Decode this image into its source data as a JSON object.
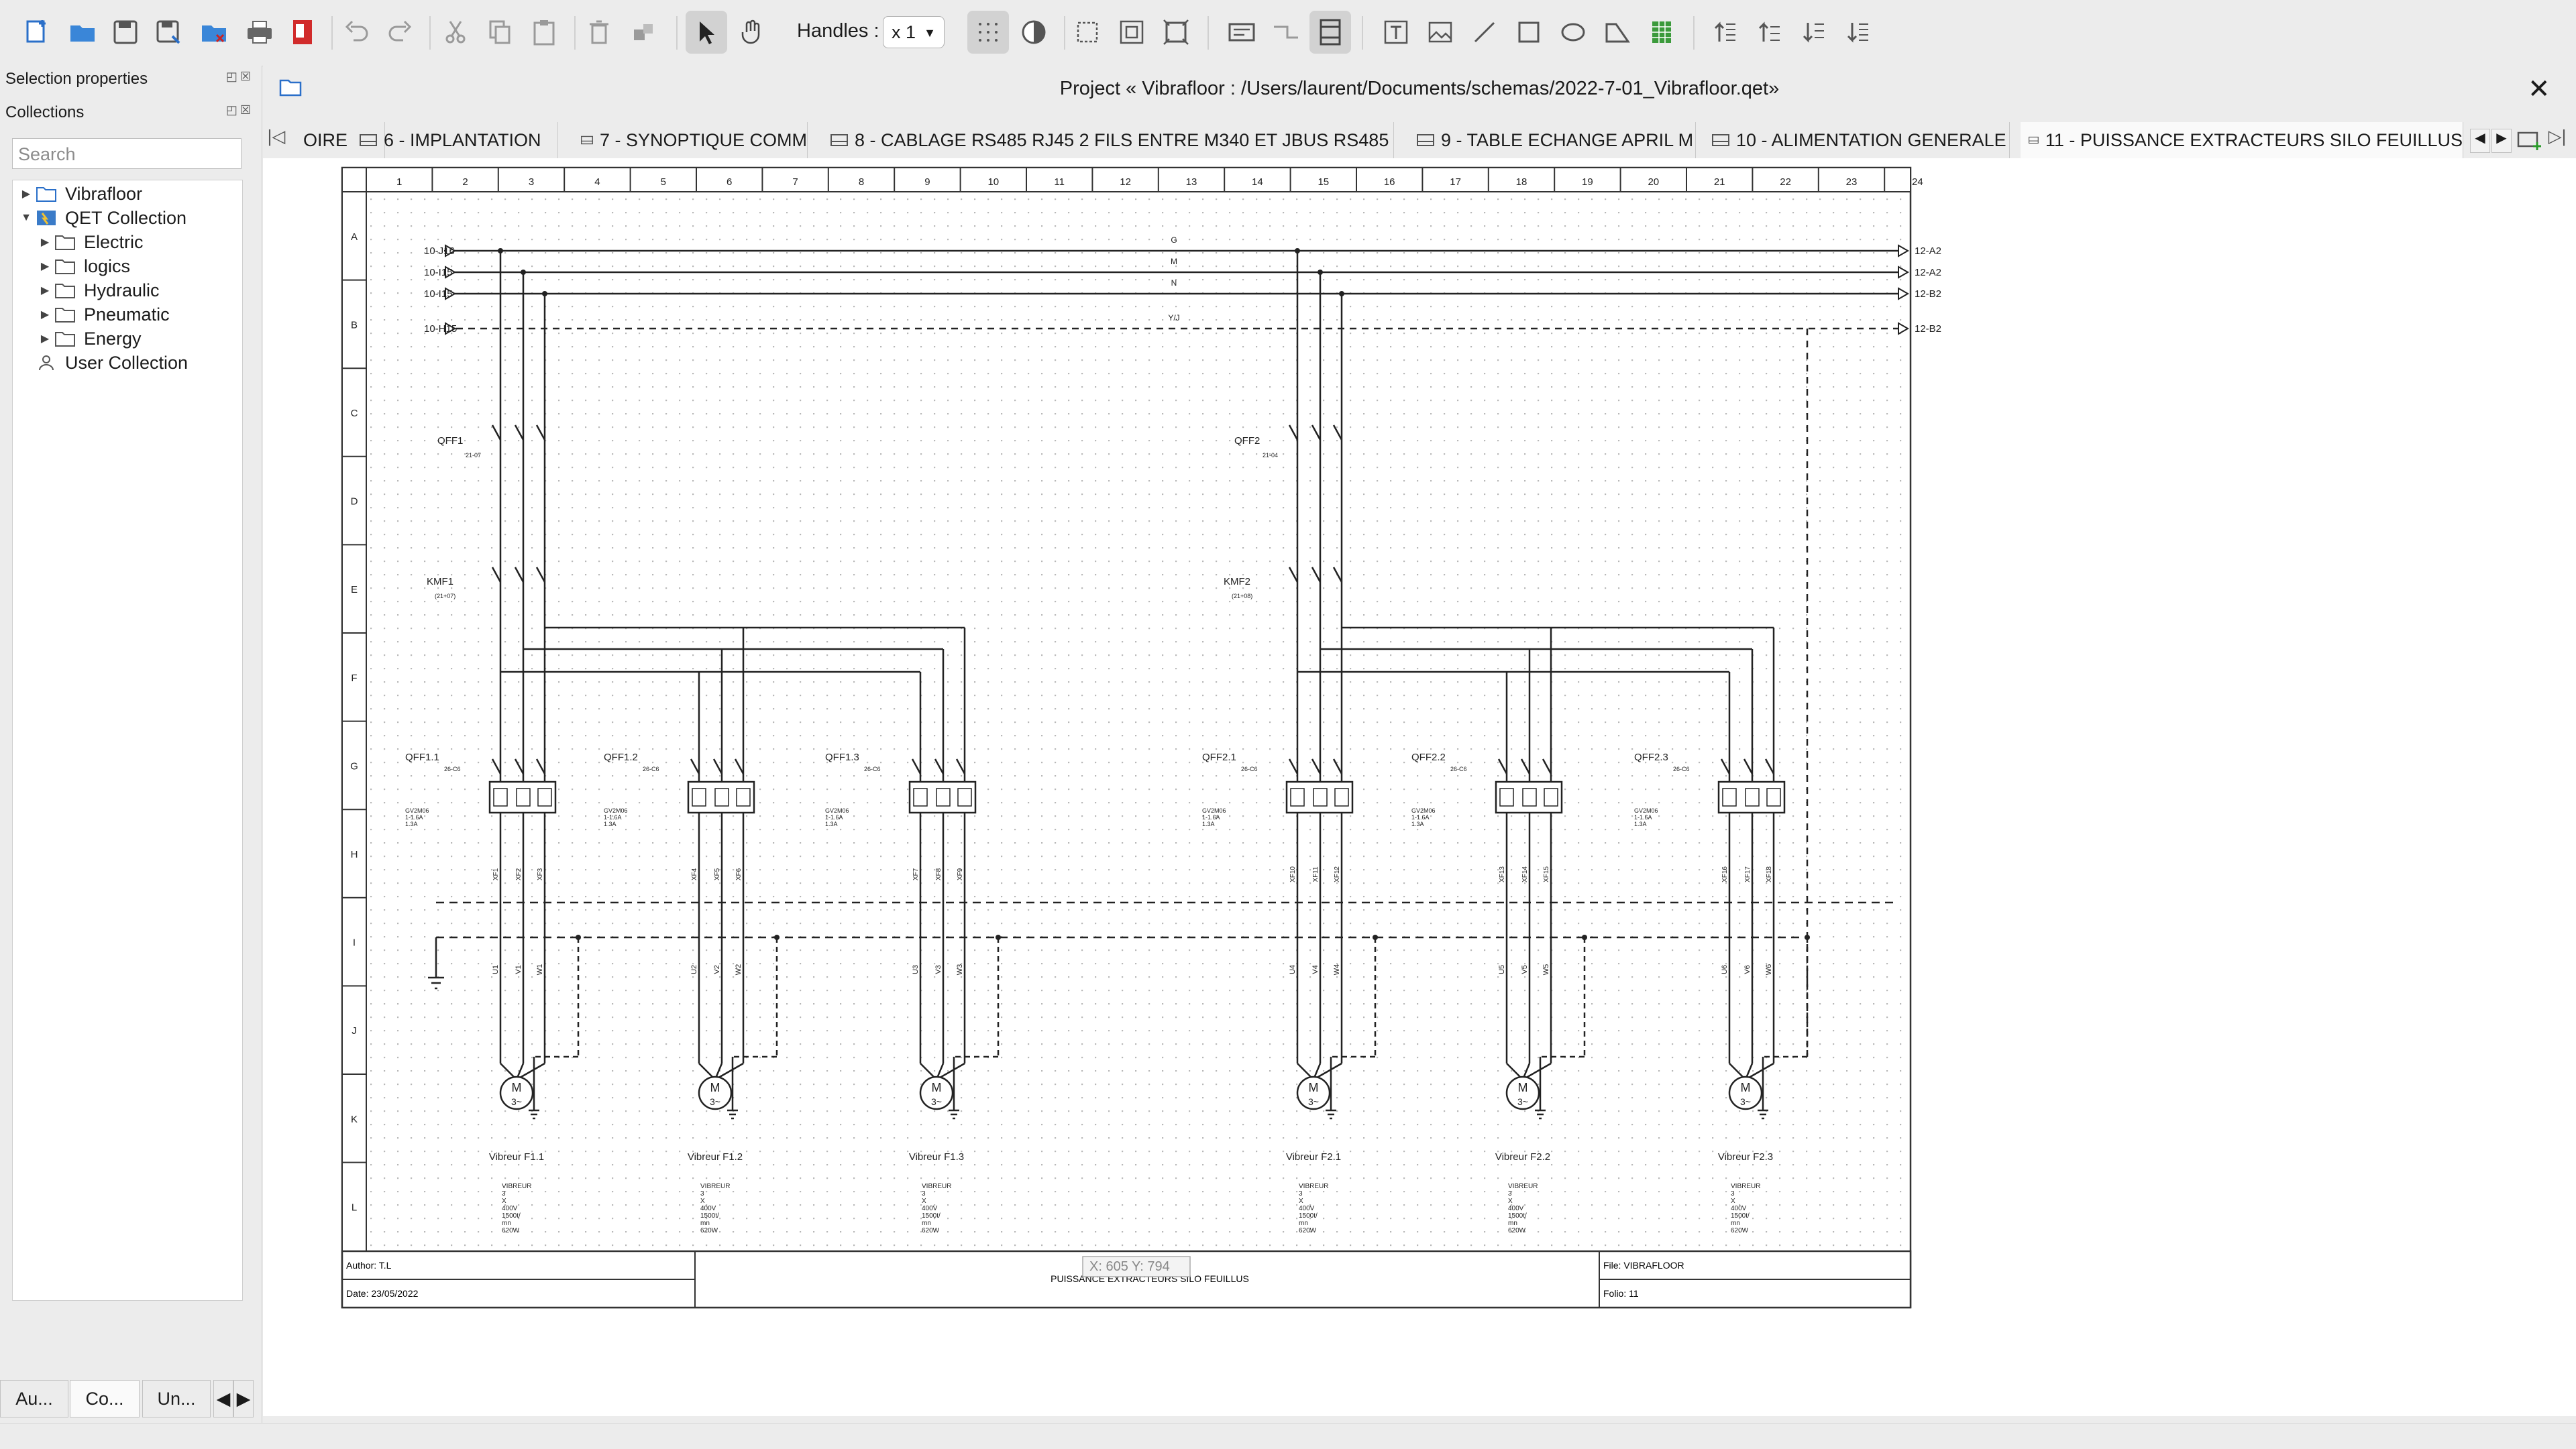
{
  "toolbar": {
    "handles_label": "Handles :",
    "handles_value": "x 1",
    "icons": [
      "new-project-icon",
      "open-icon",
      "save-icon",
      "save-as-icon",
      "close-project-icon",
      "print-icon",
      "export-pdf-icon",
      "undo-icon",
      "redo-icon",
      "cut-icon",
      "copy-icon",
      "paste-icon",
      "delete-icon",
      "rotate-icon",
      "select-tool-icon",
      "hand-tool-icon",
      "grid-icon",
      "eraser-icon",
      "select-all-icon",
      "zoom-fit-icon",
      "zoom-reset-icon",
      "text-field-icon",
      "conductor-icon",
      "terminal-strip-icon",
      "add-text-icon",
      "add-image-icon",
      "line-icon",
      "rectangle-icon",
      "ellipse-icon",
      "polygon-icon",
      "table-icon",
      "bring-front-icon",
      "raise-icon",
      "lower-icon",
      "send-back-icon"
    ]
  },
  "left_panel": {
    "selection_properties": "Selection properties",
    "collections": "Collections",
    "search_placeholder": "Search",
    "tree": [
      {
        "label": "Vibrafloor",
        "level": 0,
        "expanded": false,
        "icon": "folder-blue-icon"
      },
      {
        "label": "QET Collection",
        "level": 0,
        "expanded": true,
        "icon": "qet-collection-icon"
      },
      {
        "label": "Electric",
        "level": 1,
        "expanded": false,
        "icon": "folder-icon"
      },
      {
        "label": "logics",
        "level": 1,
        "expanded": false,
        "icon": "folder-icon"
      },
      {
        "label": "Hydraulic",
        "level": 1,
        "expanded": false,
        "icon": "folder-icon"
      },
      {
        "label": "Pneumatic",
        "level": 1,
        "expanded": false,
        "icon": "folder-icon"
      },
      {
        "label": "Energy",
        "level": 1,
        "expanded": false,
        "icon": "folder-icon"
      },
      {
        "label": "User Collection",
        "level": 0,
        "expanded": null,
        "icon": "user-icon"
      }
    ],
    "bottom_tabs": [
      "Au...",
      "Co...",
      "Un..."
    ]
  },
  "project": {
    "title": "Project « Vibrafloor : /Users/laurent/Documents/schemas/2022-7-01_Vibrafloor.qet»"
  },
  "tabs": [
    {
      "label": "OIRE",
      "active": false,
      "icon": false
    },
    {
      "label": "6 - IMPLANTATION",
      "active": false,
      "icon": true
    },
    {
      "label": "7 - SYNOPTIQUE COMM",
      "active": false,
      "icon": true
    },
    {
      "label": "8 - CABLAGE RS485 RJ45 2 FILS ENTRE M340 ET JBUS RS485",
      "active": false,
      "icon": true
    },
    {
      "label": "9 - TABLE ECHANGE APRIL M",
      "active": false,
      "icon": true
    },
    {
      "label": "10 - ALIMENTATION GENERALE",
      "active": false,
      "icon": true
    },
    {
      "label": "11 - PUISSANCE EXTRACTEURS SILO FEUILLUS",
      "active": true,
      "icon": true
    }
  ],
  "schematic": {
    "columns": [
      "1",
      "2",
      "3",
      "4",
      "5",
      "6",
      "7",
      "8",
      "9",
      "10",
      "11",
      "12",
      "13",
      "14",
      "15",
      "16",
      "17",
      "18",
      "19",
      "20",
      "21",
      "22",
      "23",
      "24"
    ],
    "rows": [
      "A",
      "B",
      "C",
      "D",
      "E",
      "F",
      "G",
      "H",
      "I",
      "J",
      "K",
      "L"
    ],
    "bus_left": [
      "10-J16",
      "10-I15",
      "10-I15",
      "10-H15"
    ],
    "bus_right": [
      "12-A2",
      "12-A2",
      "12-B2",
      "12-B2"
    ],
    "bus_labels": [
      "G",
      "M",
      "N",
      "Y/J"
    ],
    "breakers_main": [
      "QFF1",
      "QFF2"
    ],
    "breakers_main_refs": [
      "21-07",
      "21-04"
    ],
    "contactors": [
      "KMF1",
      "KMF2"
    ],
    "contactor_refs": [
      "(21+07)",
      "(21+08)"
    ],
    "motor_breakers": [
      "QFF1.1",
      "QFF1.2",
      "QFF1.3",
      "QFF2.1",
      "QFF2.2",
      "QFF2.3"
    ],
    "motor_breaker_refs": [
      "26-C6",
      "26-C6",
      "26-C6",
      "26-C6",
      "26-C6",
      "26-C6"
    ],
    "breaker_specs": [
      "GV2M06",
      "1-1.6A",
      "1.3A"
    ],
    "cable_labels": [
      [
        "XF1",
        "XF2",
        "XF3"
      ],
      [
        "XF4",
        "XF5",
        "XF6"
      ],
      [
        "XF7",
        "XF8",
        "XF9"
      ],
      [
        "XF10",
        "XF11",
        "XF12"
      ],
      [
        "XF13",
        "XF14",
        "XF15"
      ],
      [
        "XF16",
        "XF17",
        "XF18"
      ]
    ],
    "phase_labels": [
      [
        "U1",
        "V1",
        "W1"
      ],
      [
        "U2",
        "V2",
        "W2"
      ],
      [
        "U3",
        "V3",
        "W3"
      ],
      [
        "U4",
        "V4",
        "W4"
      ],
      [
        "U5",
        "V5",
        "W5"
      ],
      [
        "U6",
        "V6",
        "W6"
      ]
    ],
    "motor_symbol": "M",
    "motor_sub": "3~",
    "motors": [
      "Vibreur F1.1",
      "Vibreur F1.2",
      "Vibreur F1.3",
      "Vibreur F2.1",
      "Vibreur F2.2",
      "Vibreur F2.3"
    ],
    "motor_specs": [
      "VIBREUR",
      "3",
      "X",
      "400V",
      "1500t/",
      "mn",
      "620W"
    ]
  },
  "title_block": {
    "author": "Author: T.L",
    "date": "Date: 23/05/2022",
    "title": "PUISSANCE EXTRACTEURS SILO FEUILLUS",
    "file": "File: VIBRAFLOOR",
    "folio": "Folio: 11",
    "coords": "X: 605 Y: 794"
  }
}
